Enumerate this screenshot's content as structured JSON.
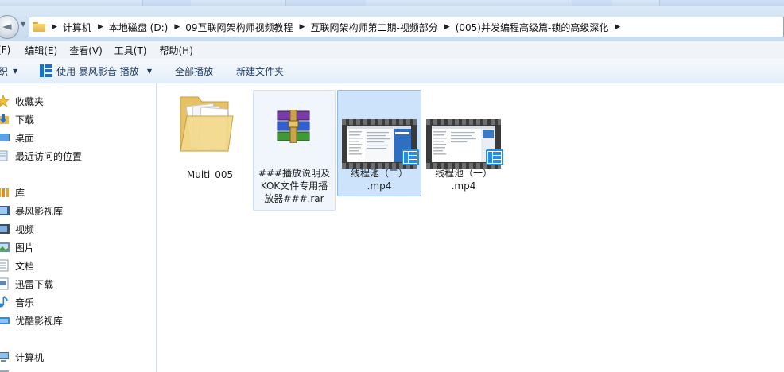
{
  "breadcrumb": [
    "计算机",
    "本地磁盘 (D:)",
    "09互联网架构师视频教程",
    "互联网架构师第二期-视频部分",
    "(005)并发编程高级篇-锁的高级深化"
  ],
  "menu": [
    "(F)",
    "编辑(E)",
    "查看(V)",
    "工具(T)",
    "帮助(H)"
  ],
  "toolbar": {
    "organize": "织",
    "play_with": "使用 暴风影音 播放",
    "play_all": "全部播放",
    "new_folder": "新建文件夹"
  },
  "nav": {
    "favorites": "收藏夹",
    "downloads": "下载",
    "desktop": "桌面",
    "recent": "最近访问的位置",
    "libraries": "库",
    "baofeng": "暴风影视库",
    "videos": "视频",
    "pictures": "图片",
    "documents": "文档",
    "thunder": "迅雷下载",
    "music": "音乐",
    "youku": "优酷影视库",
    "computer": "计算机"
  },
  "files": [
    {
      "label": "Multi_005",
      "type": "folder"
    },
    {
      "label": "###播放说明及KOK文件专用播放器###.rar",
      "lines": [
        "###播放说明及",
        "KOK文件专用播",
        "放器###.rar"
      ],
      "type": "rar"
    },
    {
      "label": "线程池（二）.mp4",
      "lines": [
        "线程池（二）",
        ".mp4"
      ],
      "type": "video"
    },
    {
      "label": "线程池（一）.mp4",
      "lines": [
        "线程池（一）",
        ".mp4"
      ],
      "type": "video"
    }
  ],
  "colors": {
    "selected_bg": "#cde3fb",
    "selected_border": "#8fb9e8",
    "toolbar_text": "#1e395b"
  }
}
